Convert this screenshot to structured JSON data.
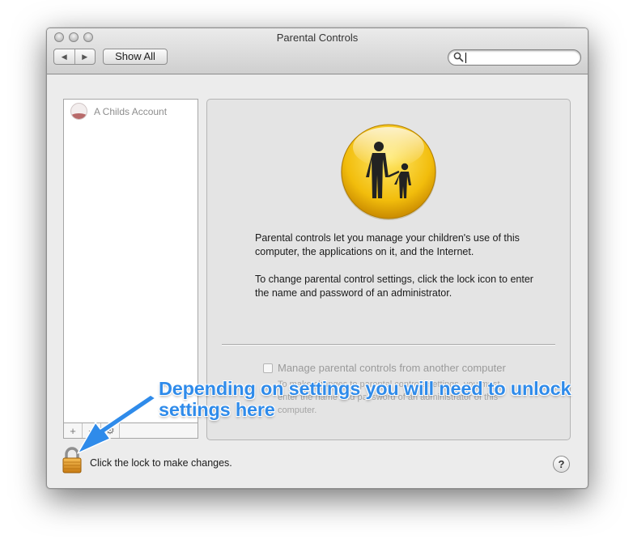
{
  "window": {
    "title": "Parental Controls"
  },
  "toolbar": {
    "back_glyph": "◀",
    "forward_glyph": "▶",
    "show_all_label": "Show All",
    "search_value": ""
  },
  "sidebar": {
    "accounts": [
      {
        "label": "A Childs Account",
        "icon": "child-avatar-icon"
      }
    ],
    "add_glyph": "+",
    "remove_glyph": "−"
  },
  "panel": {
    "icon": "parent-child-icon",
    "description": [
      "Parental controls let you manage your children's use of this computer, the applications on it, and the Internet.",
      "To change parental control settings, click the lock icon to enter the name and password of an administrator."
    ],
    "remote_checkbox_label": "Manage parental controls from another computer",
    "remote_checkbox_checked": false,
    "remote_note": "To make changes to parental controls settings, you must enter the name and password of an administrator of this computer."
  },
  "footer": {
    "lock_label": "Click the lock to make changes.",
    "help_label": "?"
  },
  "annotation": {
    "line1": "Depending on settings you will need to unlock",
    "line2": "settings here",
    "color": "#2f8bea"
  }
}
